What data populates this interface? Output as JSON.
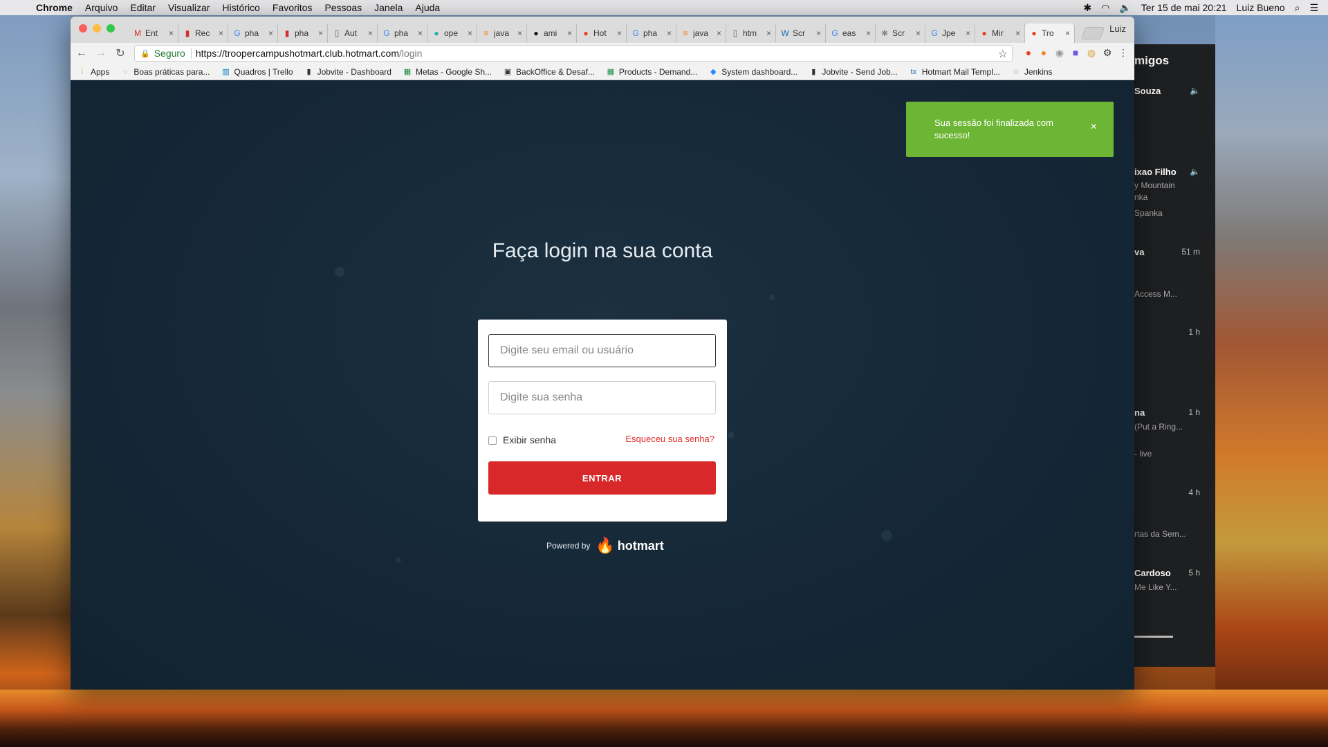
{
  "menubar": {
    "app": "Chrome",
    "items": [
      "Arquivo",
      "Editar",
      "Visualizar",
      "Histórico",
      "Favoritos",
      "Pessoas",
      "Janela",
      "Ajuda"
    ],
    "datetime": "Ter 15 de mai  20:21",
    "user": "Luiz Bueno"
  },
  "side_panel": {
    "title": "migos",
    "rows": [
      {
        "name": "Souza",
        "sub": "",
        "time": ""
      },
      {
        "name": "ixao Filho",
        "sub": "y Mountain",
        "sub2": "nka",
        "sub3": "Spanka",
        "time": ""
      },
      {
        "name": "va",
        "sub": "Access M...",
        "time": "51 m"
      },
      {
        "name": "",
        "sub": "",
        "time": "1 h"
      },
      {
        "name": "na",
        "sub": "(Put a Ring...",
        "sub2": "- live",
        "time": "1 h"
      },
      {
        "name": "",
        "sub": "rtas da Sem...",
        "time": "4 h"
      },
      {
        "name": "Cardoso",
        "sub": "Me Like Y...",
        "time": "5 h"
      }
    ]
  },
  "tabs": [
    {
      "icon": "gmail-icon",
      "label": "Ent"
    },
    {
      "icon": "red-doc-icon",
      "label": "Rec"
    },
    {
      "icon": "google-icon",
      "label": "pha"
    },
    {
      "icon": "red-doc-icon",
      "label": "pha"
    },
    {
      "icon": "page-icon",
      "label": "Aut"
    },
    {
      "icon": "google-icon",
      "label": "pha"
    },
    {
      "icon": "teal-icon",
      "label": "ope"
    },
    {
      "icon": "stack-icon",
      "label": "java"
    },
    {
      "icon": "github-icon",
      "label": "ami"
    },
    {
      "icon": "hotmart-icon",
      "label": "Hot"
    },
    {
      "icon": "google-icon",
      "label": "pha"
    },
    {
      "icon": "stack-icon",
      "label": "java"
    },
    {
      "icon": "page-icon",
      "label": "htm"
    },
    {
      "icon": "w3-icon",
      "label": "Scr"
    },
    {
      "icon": "google-icon",
      "label": "eas"
    },
    {
      "icon": "gear-icon",
      "label": "Scr"
    },
    {
      "icon": "google-icon",
      "label": "Jpe"
    },
    {
      "icon": "hotmart-icon",
      "label": "Mir"
    },
    {
      "icon": "hotmart-icon",
      "label": "Tro"
    }
  ],
  "profile": "Luiz",
  "address": {
    "secure": "Seguro",
    "host": "https://troopercampushotmart.club.hotmart.com",
    "path": "/login"
  },
  "bookmarks": [
    {
      "icon": "apps-icon",
      "label": "Apps",
      "color": "#e0a020"
    },
    {
      "icon": "loading-icon",
      "label": "Boas práticas para...",
      "color": "#3b7bd4"
    },
    {
      "icon": "trello-icon",
      "label": "Quadros | Trello",
      "color": "#0079bf"
    },
    {
      "icon": "jobvite-icon",
      "label": "Jobvite - Dashboard",
      "color": "#333333"
    },
    {
      "icon": "sheets-icon",
      "label": "Metas - Google Sh...",
      "color": "#1e8e3e"
    },
    {
      "icon": "backoffice-icon",
      "label": "BackOffice & Desaf...",
      "color": "#333333"
    },
    {
      "icon": "sheets-icon",
      "label": "Products - Demand...",
      "color": "#1e8e3e"
    },
    {
      "icon": "jira-icon",
      "label": "System dashboard...",
      "color": "#2684ff"
    },
    {
      "icon": "jobvite-icon",
      "label": "Jobvite - Send Job...",
      "color": "#333333"
    },
    {
      "icon": "tx-icon",
      "label": "Hotmart Mail Templ...",
      "color": "#1b6fb3"
    },
    {
      "icon": "jenkins-icon",
      "label": "Jenkins",
      "color": "#c8a070"
    }
  ],
  "page": {
    "title": "Faça login na sua conta",
    "email_placeholder": "Digite seu email ou usuário",
    "password_placeholder": "Digite sua senha",
    "show_password": "Exibir senha",
    "forgot": "Esqueceu sua senha?",
    "submit": "ENTRAR",
    "powered_by": "Powered by",
    "brand": "hotmart"
  },
  "toast": {
    "message": "Sua sessão foi finalizada com sucesso!",
    "close": "×"
  }
}
